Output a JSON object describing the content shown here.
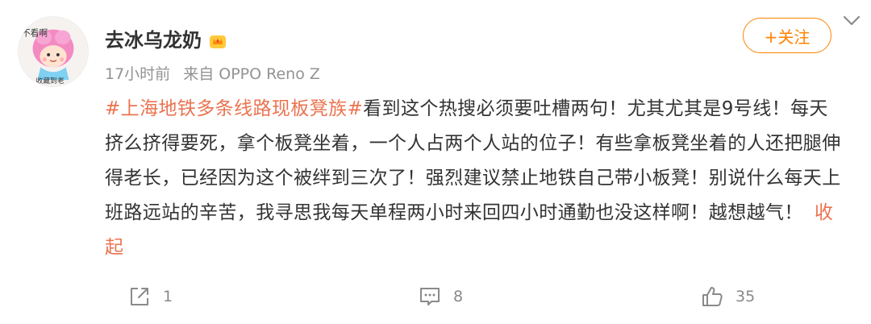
{
  "user": {
    "name": "去冰乌龙奶",
    "avatar_text_top": "不看啊",
    "avatar_text_bottom": "收藏到老"
  },
  "meta": {
    "time": "17小时前",
    "source": "来自 OPPO Reno Z"
  },
  "follow_button": {
    "label": "+关注"
  },
  "post": {
    "hashtag": "#上海地铁多条线路现板凳族#",
    "body": "看到这个热搜必须要吐槽两句！尤其尤其是9号线！每天挤么挤得要死，拿个板凳坐着，一个人占两个人站的位子！有些拿板凳坐着的人还把腿伸得老长，已经因为这个被绊到三次了！强烈建议禁止地铁自己带小板凳！别说什么每天上班路远站的辛苦，我寻思我每天单程两小时来回四小时通勤也没这样啊！越想越气！",
    "collapse_label": "收起"
  },
  "actions": {
    "repost_count": "1",
    "comment_count": "8",
    "like_count": "35"
  },
  "icons": {
    "badge": "crown-badge-icon",
    "more": "chevron-down-icon",
    "repost": "share-icon",
    "comment": "comment-icon",
    "like": "thumbs-up-icon"
  },
  "colors": {
    "accent": "#ff8200",
    "hashtag": "#eb7350",
    "muted": "#939393"
  }
}
